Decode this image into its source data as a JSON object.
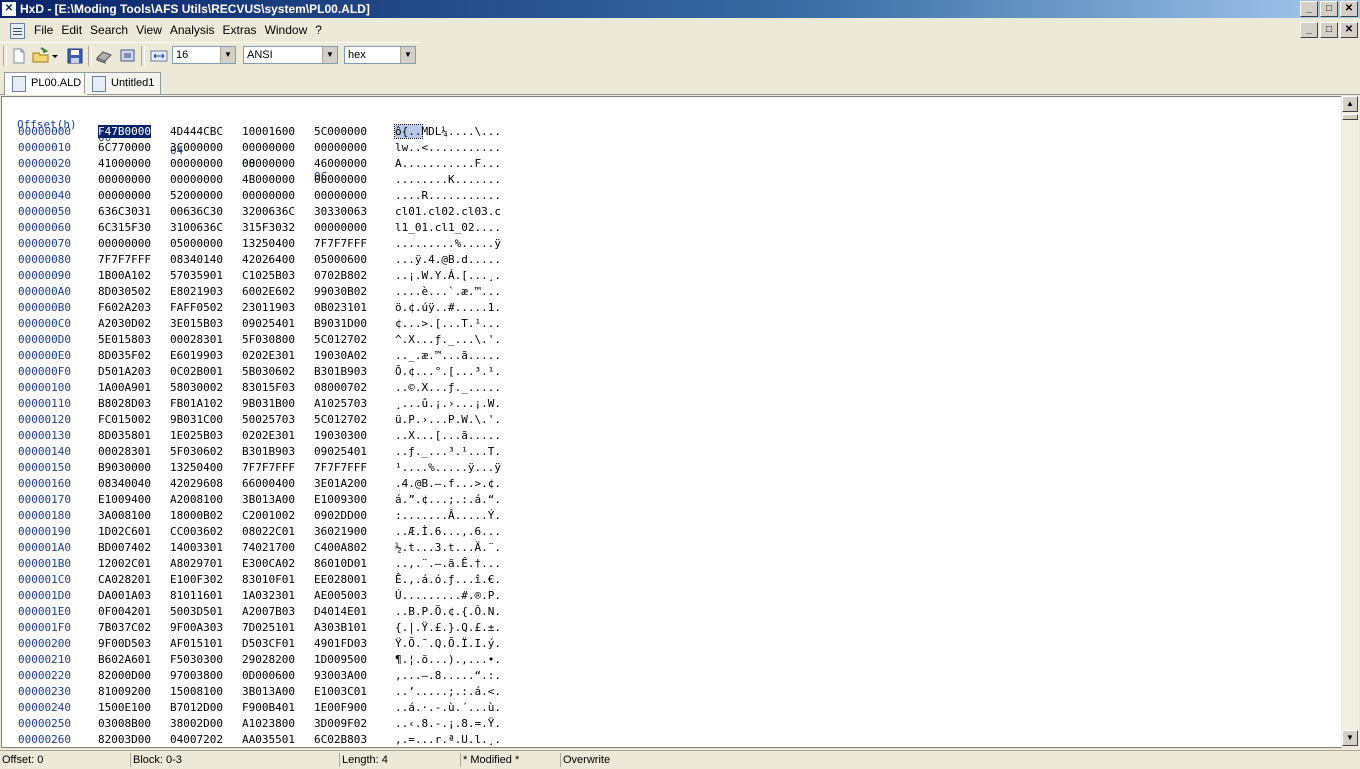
{
  "window": {
    "title": "HxD - [E:\\Moding Tools\\AFS Utils\\RECVUS\\system\\PL00.ALD]",
    "controls": [
      "_",
      "□",
      "✕"
    ]
  },
  "menu": {
    "items": [
      "File",
      "Edit",
      "Search",
      "View",
      "Analysis",
      "Extras",
      "Window",
      "?"
    ]
  },
  "toolbar": {
    "bytes_per_row": "16",
    "charset": "ANSI",
    "display_mode": "hex"
  },
  "tabs": [
    {
      "label": "PL00.ALD",
      "active": true
    },
    {
      "label": "Untitled1",
      "active": false
    }
  ],
  "editor": {
    "header_offset": "Offset(h)",
    "header_cols": [
      "00",
      "04",
      "08",
      "0C"
    ],
    "rows": [
      {
        "off": "00000000",
        "hex": [
          "F47B0000",
          "4D444CBC",
          "10001600",
          "5C000000"
        ],
        "ascii": "ô{..MDL¼....\\..."
      },
      {
        "off": "00000010",
        "hex": [
          "6C770000",
          "3C000000",
          "00000000",
          "00000000"
        ],
        "ascii": "lw..<..........."
      },
      {
        "off": "00000020",
        "hex": [
          "41000000",
          "00000000",
          "00000000",
          "46000000"
        ],
        "ascii": "A...........F..."
      },
      {
        "off": "00000030",
        "hex": [
          "00000000",
          "00000000",
          "4B000000",
          "00000000"
        ],
        "ascii": "........K......."
      },
      {
        "off": "00000040",
        "hex": [
          "00000000",
          "52000000",
          "00000000",
          "00000000"
        ],
        "ascii": "....R..........."
      },
      {
        "off": "00000050",
        "hex": [
          "636C3031",
          "00636C30",
          "3200636C",
          "30330063"
        ],
        "ascii": "cl01.cl02.cl03.c"
      },
      {
        "off": "00000060",
        "hex": [
          "6C315F30",
          "3100636C",
          "315F3032",
          "00000000"
        ],
        "ascii": "l1_01.cl1_02...."
      },
      {
        "off": "00000070",
        "hex": [
          "00000000",
          "05000000",
          "13250400",
          "7F7F7FFF"
        ],
        "ascii": ".........%.....ÿ"
      },
      {
        "off": "00000080",
        "hex": [
          "7F7F7FFF",
          "08340140",
          "42026400",
          "05000600"
        ],
        "ascii": "...ÿ.4.@B.d....."
      },
      {
        "off": "00000090",
        "hex": [
          "1B00A102",
          "57035901",
          "C1025B03",
          "0702B802"
        ],
        "ascii": "..¡.W.Y.Á.[...¸."
      },
      {
        "off": "000000A0",
        "hex": [
          "8D030502",
          "E8021903",
          "6002E602",
          "99030B02"
        ],
        "ascii": "....è...`.æ.™..."
      },
      {
        "off": "000000B0",
        "hex": [
          "F602A203",
          "FAFF0502",
          "23011903",
          "0B023101"
        ],
        "ascii": "ö.¢.úÿ..#.....1."
      },
      {
        "off": "000000C0",
        "hex": [
          "A2030D02",
          "3E015B03",
          "09025401",
          "B9031D00"
        ],
        "ascii": "¢...>.[...T.¹..."
      },
      {
        "off": "000000D0",
        "hex": [
          "5E015803",
          "00028301",
          "5F030800",
          "5C012702"
        ],
        "ascii": "^.X...ƒ._...\\.'."
      },
      {
        "off": "000000E0",
        "hex": [
          "8D035F02",
          "E6019903",
          "0202E301",
          "19030A02"
        ],
        "ascii": ".._.æ.™...ã....."
      },
      {
        "off": "000000F0",
        "hex": [
          "D501A203",
          "0C02B001",
          "5B030602",
          "B301B903"
        ],
        "ascii": "Õ.¢...°.[...³.¹."
      },
      {
        "off": "00000100",
        "hex": [
          "1A00A901",
          "58030002",
          "83015F03",
          "08000702"
        ],
        "ascii": "..©.X...ƒ._....."
      },
      {
        "off": "00000110",
        "hex": [
          "B8028D03",
          "FB01A102",
          "9B031B00",
          "A1025703"
        ],
        "ascii": "¸...û.¡.›...¡.W."
      },
      {
        "off": "00000120",
        "hex": [
          "FC015002",
          "9B031C00",
          "50025703",
          "5C012702"
        ],
        "ascii": "ü.P.›...P.W.\\.'."
      },
      {
        "off": "00000130",
        "hex": [
          "8D035801",
          "1E025B03",
          "0202E301",
          "19030300"
        ],
        "ascii": "..X...[...ã....."
      },
      {
        "off": "00000140",
        "hex": [
          "00028301",
          "5F030602",
          "B301B903",
          "09025401"
        ],
        "ascii": "..ƒ._...³.¹...T."
      },
      {
        "off": "00000150",
        "hex": [
          "B9030000",
          "13250400",
          "7F7F7FFF",
          "7F7F7FFF"
        ],
        "ascii": "¹....%.....ÿ...ÿ"
      },
      {
        "off": "00000160",
        "hex": [
          "08340040",
          "42029608",
          "66000400",
          "3E01A200"
        ],
        "ascii": ".4.@B.–.f...>.¢."
      },
      {
        "off": "00000170",
        "hex": [
          "E1009400",
          "A2008100",
          "3B013A00",
          "E1009300"
        ],
        "ascii": "á.”.¢...;.:.á.“."
      },
      {
        "off": "00000180",
        "hex": [
          "3A008100",
          "18000B02",
          "C2001002",
          "0902DD00"
        ],
        "ascii": ":.......Â.....Ý."
      },
      {
        "off": "00000190",
        "hex": [
          "1D02C601",
          "CC003602",
          "08022C01",
          "36021900"
        ],
        "ascii": "..Æ.Ì.6...,.6..."
      },
      {
        "off": "000001A0",
        "hex": [
          "BD007402",
          "14003301",
          "74021700",
          "C400A802"
        ],
        "ascii": "½.t...3.t...Ä.¨."
      },
      {
        "off": "000001B0",
        "hex": [
          "12002C01",
          "A8029701",
          "E300CA02",
          "86010D01"
        ],
        "ascii": "..,.¨.—.ã.Ê.†..."
      },
      {
        "off": "000001C0",
        "hex": [
          "CA028201",
          "E100F302",
          "83010F01",
          "EE028001"
        ],
        "ascii": "Ê.‚.á.ó.ƒ...î.€."
      },
      {
        "off": "000001D0",
        "hex": [
          "DA001A03",
          "81011601",
          "1A032301",
          "AE005003"
        ],
        "ascii": "Ú.........#.®.P."
      },
      {
        "off": "000001E0",
        "hex": [
          "0F004201",
          "5003D501",
          "A2007B03",
          "D4014E01"
        ],
        "ascii": "..B.P.Õ.¢.{.Ô.N."
      },
      {
        "off": "000001F0",
        "hex": [
          "7B037C02",
          "9F00A303",
          "7D025101",
          "A303B101"
        ],
        "ascii": "{.|.Ÿ.£.}.Q.£.±."
      },
      {
        "off": "00000200",
        "hex": [
          "9F00D503",
          "AF015101",
          "D503CF01",
          "4901FD03"
        ],
        "ascii": "Ÿ.Õ.¯.Q.Õ.Ï.I.ý."
      },
      {
        "off": "00000210",
        "hex": [
          "B602A601",
          "F5030300",
          "29028200",
          "1D009500"
        ],
        "ascii": "¶.¦.õ...).‚...•."
      },
      {
        "off": "00000220",
        "hex": [
          "82000D00",
          "97003800",
          "0D000600",
          "93003A00"
        ],
        "ascii": "‚...—.8.....“.:."
      },
      {
        "off": "00000230",
        "hex": [
          "81009200",
          "15008100",
          "3B013A00",
          "E1003C01"
        ],
        "ascii": "..’.....;.:.á.<."
      },
      {
        "off": "00000240",
        "hex": [
          "1500E100",
          "B7012D00",
          "F900B401",
          "1E00F900"
        ],
        "ascii": "..á.·.-.ù.´...ù."
      },
      {
        "off": "00000250",
        "hex": [
          "03008B00",
          "38002D00",
          "A1023800",
          "3D009F02"
        ],
        "ascii": "..‹.8.-.¡.8.=.Ÿ."
      },
      {
        "off": "00000260",
        "hex": [
          "82003D00",
          "04007202",
          "AA035501",
          "6C02B803"
        ],
        "ascii": "‚.=...r.ª.U.l.¸."
      }
    ]
  },
  "status": {
    "offset": "Offset: 0",
    "block": "Block: 0-3",
    "length": "Length: 4",
    "modified": "* Modified *",
    "mode": "Overwrite"
  }
}
